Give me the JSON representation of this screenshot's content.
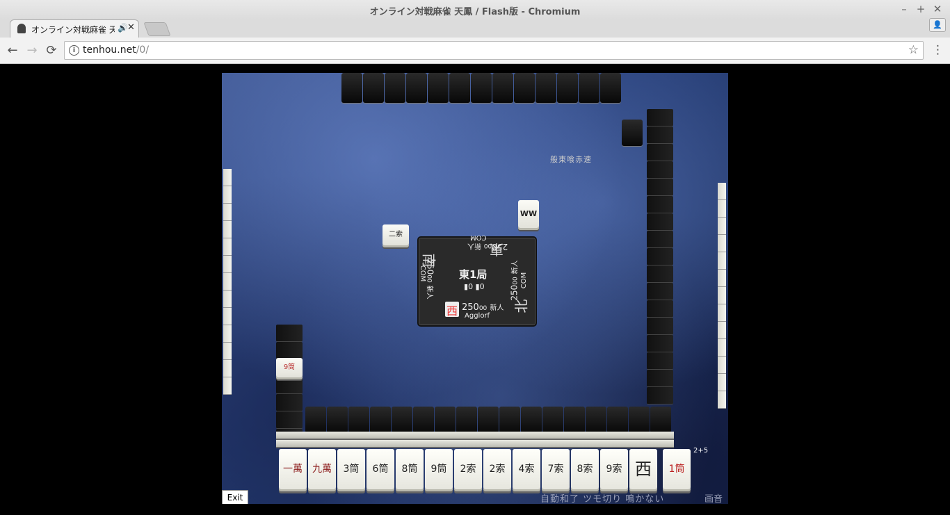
{
  "window": {
    "title": "オンライン対戦麻雀 天鳳 / Flash版 - Chromium",
    "minimize": "–",
    "maximize": "+",
    "close": "✕"
  },
  "tab": {
    "title": "オンライン対戦麻雀 天",
    "audio_icon": "🔊",
    "close": "✕"
  },
  "profile_icon": "👤",
  "toolbar": {
    "back": "←",
    "forward": "→",
    "reload": "⟳",
    "info": "i",
    "url_host": "tenhou.net",
    "url_path": "/0/",
    "bookmark": "☆",
    "menu": "⋮"
  },
  "game": {
    "rule_text": "般東喰赤速",
    "round": "東1局",
    "honba": "0",
    "riichi_sticks": "0",
    "players": {
      "self": {
        "wind": "西",
        "score": "250",
        "score_small": "00",
        "rank": "新人",
        "name": "Agglorf"
      },
      "right": {
        "wind": "北",
        "score": "250",
        "score_small": "00",
        "rank": "新人",
        "name": "COM"
      },
      "top": {
        "wind": "東",
        "score": "250",
        "score_small": "00",
        "rank": "新人",
        "name": "COM"
      },
      "left": {
        "wind": "南",
        "score": "250",
        "score_small": "00",
        "rank": "新人",
        "name": "COM"
      }
    },
    "discards": {
      "top_tile": "WW",
      "left_tile": "二索",
      "self_tile": "9筒"
    },
    "hand": [
      "一萬",
      "九萬",
      "3筒",
      "6筒",
      "8筒",
      "9筒",
      "2索",
      "2索",
      "4索",
      "7索",
      "8索",
      "9索",
      "西"
    ],
    "drawn_tile": "1筒",
    "wall_count": "2+5",
    "status_bar": "自動和了  ツモ切り  鳴かない",
    "sound_label": "画音",
    "exit_label": "Exit"
  }
}
